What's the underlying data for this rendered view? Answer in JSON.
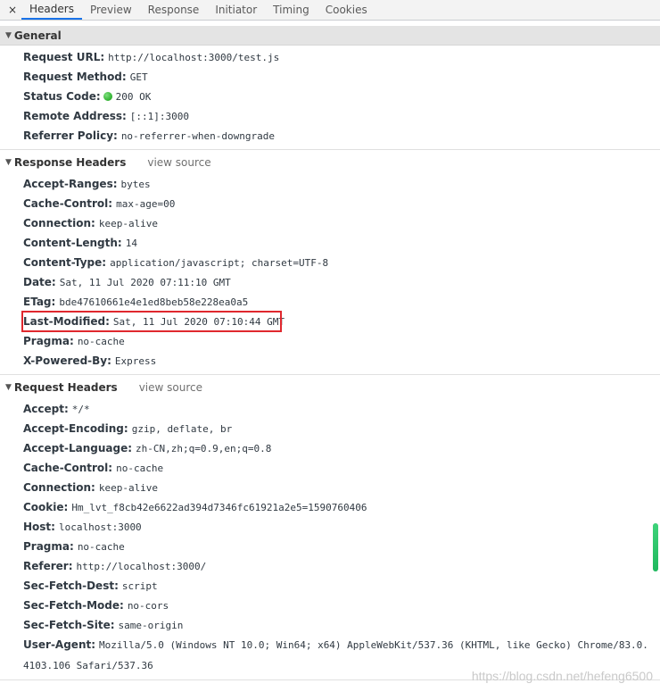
{
  "tabs": {
    "close": "×",
    "items": [
      "Headers",
      "Preview",
      "Response",
      "Initiator",
      "Timing",
      "Cookies"
    ]
  },
  "general": {
    "title": "General",
    "request_url": {
      "key": "Request URL:",
      "value": "http://localhost:3000/test.js"
    },
    "request_method": {
      "key": "Request Method:",
      "value": "GET"
    },
    "status_code": {
      "key": "Status Code:",
      "value": "200 OK",
      "status_color": "#0a9a0a"
    },
    "remote_address": {
      "key": "Remote Address:",
      "value": "[::1]:3000"
    },
    "referrer_policy": {
      "key": "Referrer Policy:",
      "value": "no-referrer-when-downgrade"
    }
  },
  "response_headers": {
    "title": "Response Headers",
    "view_source": "view source",
    "rows": [
      {
        "key": "Accept-Ranges:",
        "value": "bytes"
      },
      {
        "key": "Cache-Control:",
        "value": "max-age=00"
      },
      {
        "key": "Connection:",
        "value": "keep-alive"
      },
      {
        "key": "Content-Length:",
        "value": "14"
      },
      {
        "key": "Content-Type:",
        "value": "application/javascript; charset=UTF-8"
      },
      {
        "key": "Date:",
        "value": "Sat, 11 Jul 2020 07:11:10 GMT"
      },
      {
        "key": "ETag:",
        "value": "bde47610661e4e1ed8beb58e228ea0a5"
      },
      {
        "key": "Last-Modified:",
        "value": "Sat, 11 Jul 2020 07:10:44 GMT"
      },
      {
        "key": "Pragma:",
        "value": "no-cache"
      },
      {
        "key": "X-Powered-By:",
        "value": "Express"
      }
    ]
  },
  "request_headers": {
    "title": "Request Headers",
    "view_source": "view source",
    "rows": [
      {
        "key": "Accept:",
        "value": "*/*"
      },
      {
        "key": "Accept-Encoding:",
        "value": "gzip, deflate, br"
      },
      {
        "key": "Accept-Language:",
        "value": "zh-CN,zh;q=0.9,en;q=0.8"
      },
      {
        "key": "Cache-Control:",
        "value": "no-cache"
      },
      {
        "key": "Connection:",
        "value": "keep-alive"
      },
      {
        "key": "Cookie:",
        "value": "Hm_lvt_f8cb42e6622ad394d7346fc61921a2e5=1590760406"
      },
      {
        "key": "Host:",
        "value": "localhost:3000"
      },
      {
        "key": "Pragma:",
        "value": "no-cache"
      },
      {
        "key": "Referer:",
        "value": "http://localhost:3000/"
      },
      {
        "key": "Sec-Fetch-Dest:",
        "value": "script"
      },
      {
        "key": "Sec-Fetch-Mode:",
        "value": "no-cors"
      },
      {
        "key": "Sec-Fetch-Site:",
        "value": "same-origin"
      },
      {
        "key": "User-Agent:",
        "value": "Mozilla/5.0 (Windows NT 10.0; Win64; x64) AppleWebKit/537.36 (KHTML, like Gecko) Chrome/83.0.4103.106 Safari/537.36"
      }
    ]
  },
  "watermark": "https://blog.csdn.net/hefeng6500",
  "colors": {
    "highlight": "#e0282e",
    "active_tab": "#1a73e8",
    "scrollbar": "#2cc56b"
  }
}
